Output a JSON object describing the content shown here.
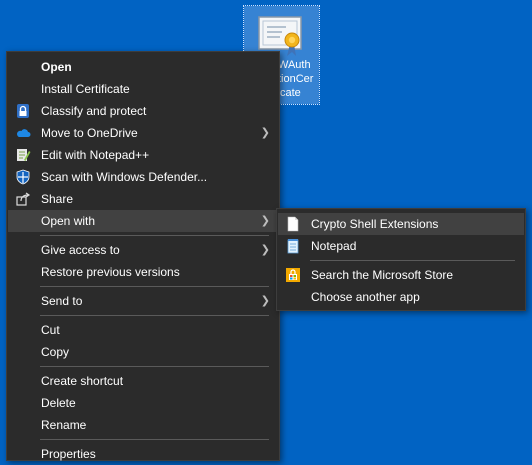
{
  "desktop": {
    "file": {
      "name_lines": [
        "WAuth",
        "tionCer",
        "cate"
      ],
      "icon": "certificate-icon"
    }
  },
  "context_menu": {
    "items": [
      {
        "label": "Open",
        "icon": ""
      },
      {
        "label": "Install Certificate",
        "icon": ""
      },
      {
        "label": "Classify and protect",
        "icon": "lock-icon"
      },
      {
        "label": "Move to OneDrive",
        "icon": "cloud-icon",
        "submenu": true
      },
      {
        "label": "Edit with Notepad++",
        "icon": "notepadpp-icon"
      },
      {
        "label": "Scan with Windows Defender...",
        "icon": "defender-shield-icon"
      },
      {
        "label": "Share",
        "icon": "share-icon"
      },
      {
        "label": "Open with",
        "icon": "",
        "submenu": true
      },
      {
        "label": "Give access to",
        "icon": "",
        "submenu": true
      },
      {
        "label": "Restore previous versions",
        "icon": ""
      },
      {
        "label": "Send to",
        "icon": "",
        "submenu": true
      },
      {
        "label": "Cut",
        "icon": ""
      },
      {
        "label": "Copy",
        "icon": ""
      },
      {
        "label": "Create shortcut",
        "icon": ""
      },
      {
        "label": "Delete",
        "icon": ""
      },
      {
        "label": "Rename",
        "icon": ""
      },
      {
        "label": "Properties",
        "icon": ""
      }
    ],
    "arrow_glyph": "❯"
  },
  "open_with_submenu": {
    "items": [
      {
        "label": "Crypto Shell Extensions",
        "icon": "document-icon"
      },
      {
        "label": "Notepad",
        "icon": "notepad-icon"
      },
      {
        "label": "Search the Microsoft Store",
        "icon": "store-icon"
      },
      {
        "label": "Choose another app",
        "icon": ""
      }
    ]
  },
  "colors": {
    "desktop": "#0163c3",
    "menu_bg": "#2b2b2b",
    "highlight": "#414141"
  }
}
